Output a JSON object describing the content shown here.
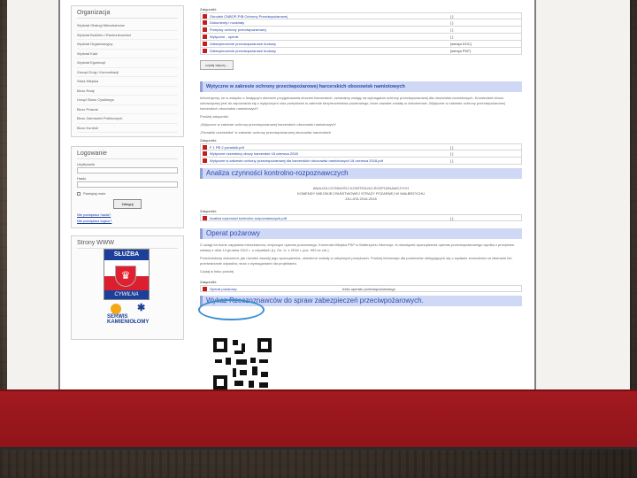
{
  "sidebar": {
    "org_title": "Organizacja",
    "menu": [
      "Wydział Obsługi Mieszkańców",
      "Wydział Budżetu i Rachunkowości",
      "Wydział Organizacyjny",
      "Wydział Kadr",
      "Wydział Egzekucji",
      "Zarząd Dróg i Komunikacji",
      "Straż Miejska",
      "Biuro Rady",
      "Urząd Stanu Cywilnego",
      "Biuro Prawne",
      "Biuro Zamówień Publicznych",
      "Biuro Kontroli"
    ],
    "login": {
      "title": "Logowanie",
      "username_label": "Użytkownik",
      "password_label": "Hasło",
      "remember_label": "Pamiętaj mnie",
      "submit": "Zaloguj",
      "forgot_password": "Nie pamiętasz hasła?",
      "forgot_username": "Nie pamiętasz loginu?"
    },
    "partners_title": "Strony WWW",
    "emblem_top": "SŁUŻBA",
    "emblem_bottom": "CYWILNA",
    "serwis_label": "SERWIS KAMIENIOŁOMY"
  },
  "content": {
    "attachments_label": "Załączniki:",
    "top_attachments": [
      {
        "name": "Ośrodek CNBOP-PIB Ochrony Przeciwpożarowej",
        "size": "[ ]"
      },
      {
        "name": "Dokumenty i rozdziały",
        "size": "[ ]"
      },
      {
        "name": "Przepisy ochrony przeciwpożarowej",
        "size": "[ ]"
      },
      {
        "name": "Wytyczne - operat",
        "size": "[ ]"
      },
      {
        "name": "Zabezpieczenie przeciwpożarowe budowy",
        "size": "[wersja DOC]"
      },
      {
        "name": "Zabezpieczenie przeciwpożarowe budowy",
        "size": "[wersja PDF]"
      }
    ],
    "more_button": "czytaj więcej...",
    "section1_title": "Wytyczne w zakresie ochrony przeciwpożarowej harcerskich obozowisk namiotowych",
    "section1_para1": "Informujemy, że w związku z trwającym okresem przygotowania obozów harcerskich, zwracamy uwagę na wymagania ochrony przeciwpożarowej dla obozowisk namiotowych. Komendant obozu zobowiązany jest do zapoznania się z wytycznymi oraz przepisami w zakresie bezpieczeństwa pożarowego, które zawarte zostały w dokumencie „Wytyczne w zakresie ochrony przeciwpożarowej harcerskich obozowisk namiotowych”.",
    "section1_para2": "Poniżej załączniki:",
    "section1_para3": "„Wytyczne w zakresie ochrony przeciwpożarowej harcerskich obozowisk namiotowych”",
    "section1_para4": "„Poradnik uczestnika” w zakresie ochrony przeciwpożarowej obozowisk harcerskich",
    "section1_attachments_label": "Załączniki:",
    "section1_attachments": [
      {
        "name": "F 1 PB 2 poradnik.pdf",
        "size": "[ ]"
      },
      {
        "name": "Wytyczne uczestnicy obozy harcerskie 18 czerwca 2018",
        "size": "[ ]"
      },
      {
        "name": "Wytyczne w zakresie ochrony przeciwpożarowej dla harcerskich obozowisk namiotowych 18 czerwca 2018.pdf",
        "size": "[ ]"
      }
    ],
    "section2_title": "Analiza czynności kontrolno-rozpoznawczych",
    "analysis_lines": [
      "ANALIZA CZYNNOŚCI KONTROLNO-ROZPOZNAWCZYCH",
      "KOMENDY MIEJSKIEJ PAŃSTWOWEJ STRAŻY POŻARNEJ W WAŁBRZYCHU",
      "ZA LATA 2016-2018"
    ],
    "section2_attachments_label": "Załączniki:",
    "section2_attachments": [
      {
        "name": "Analiza czynności kontrolno-rozpoznawczych.pdf",
        "size": "[ ]"
      }
    ],
    "section3_title": "Operat pożarowy",
    "section3_para1": "Z uwagi na liczne zapytania mieszkańców, dotyczące operatu pożarowego, Komenda Miejska PSP w Wałbrzychu informuje, iż obowiązek sporządzenia operatu przeciwpożarowego wynika z przepisów ustawy z dnia 14 grudnia 2012 r. o odpadach (t.j. Dz. U. z 2018 r. poz. 992 ze zm.).",
    "section3_para2": "Przedmiotowy dokument, jak również zasady jego sporządzenia, określone zostały w odrębnych przepisach. Poniżej informacje dla podmiotów ubiegających się o wydanie zezwolenia na zbieranie lub przetwarzanie odpadów, wraz z wymaganiami dla projektanta.",
    "section3_para3": "Czytaj w linku poniżej",
    "section3_attachments_label": "Załączniki:",
    "section3_attachments": [
      {
        "name": "Operat pożarowy",
        "size": "treść operatu przeciwpożarowego"
      }
    ],
    "section4_title": "Wykaz Rzeczoznawców do spraw zabezpieczeń przeciwpożarowych."
  },
  "colors": {
    "banner": "#a21a20",
    "section_bar": "#cfd8f4",
    "link": "#1b3fa6",
    "highlight_circle": "#3b8fd0"
  }
}
